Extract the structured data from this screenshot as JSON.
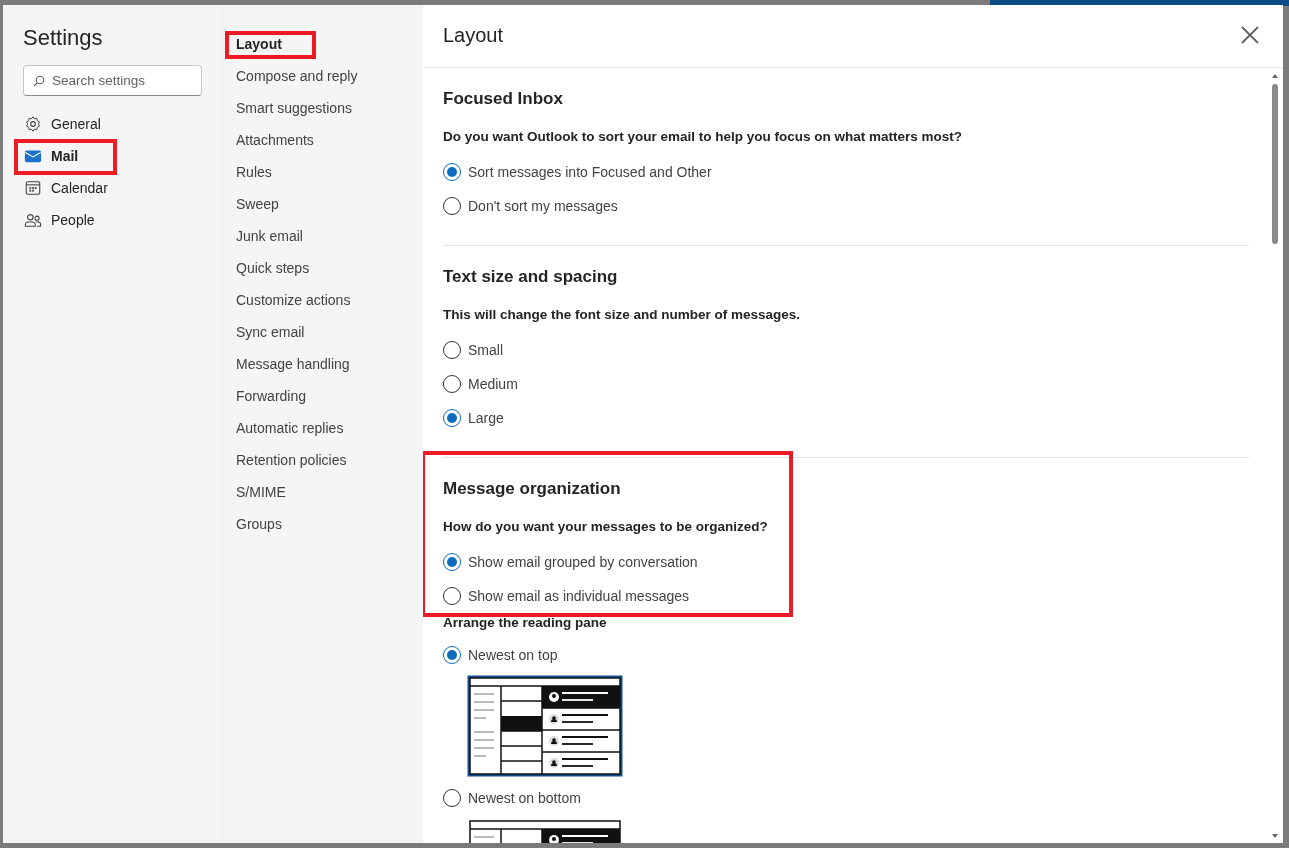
{
  "dialog": {
    "title": "Settings",
    "search": {
      "placeholder": "Search settings"
    },
    "nav": [
      {
        "kind": "general",
        "label": "General",
        "selected": false,
        "annotated": false
      },
      {
        "kind": "mail",
        "label": "Mail",
        "selected": true,
        "annotated": true
      },
      {
        "kind": "calendar",
        "label": "Calendar",
        "selected": false,
        "annotated": false
      },
      {
        "kind": "people",
        "label": "People",
        "selected": false,
        "annotated": false
      }
    ],
    "subnav": [
      {
        "label": "Layout",
        "selected": true,
        "annotated": true
      },
      {
        "label": "Compose and reply",
        "selected": false,
        "annotated": false
      },
      {
        "label": "Smart suggestions",
        "selected": false,
        "annotated": false
      },
      {
        "label": "Attachments",
        "selected": false,
        "annotated": false
      },
      {
        "label": "Rules",
        "selected": false,
        "annotated": false
      },
      {
        "label": "Sweep",
        "selected": false,
        "annotated": false
      },
      {
        "label": "Junk email",
        "selected": false,
        "annotated": false
      },
      {
        "label": "Quick steps",
        "selected": false,
        "annotated": false
      },
      {
        "label": "Customize actions",
        "selected": false,
        "annotated": false
      },
      {
        "label": "Sync email",
        "selected": false,
        "annotated": false
      },
      {
        "label": "Message handling",
        "selected": false,
        "annotated": false
      },
      {
        "label": "Forwarding",
        "selected": false,
        "annotated": false
      },
      {
        "label": "Automatic replies",
        "selected": false,
        "annotated": false
      },
      {
        "label": "Retention policies",
        "selected": false,
        "annotated": false
      },
      {
        "label": "S/MIME",
        "selected": false,
        "annotated": false
      },
      {
        "label": "Groups",
        "selected": false,
        "annotated": false
      }
    ],
    "pane": {
      "title": "Layout",
      "sections": [
        {
          "title": "Focused Inbox",
          "annotated": false,
          "items": [
            {
              "kind": "question",
              "text": "Do you want Outlook to sort your email to help you focus on what matters most?"
            },
            {
              "kind": "radio",
              "label": "Sort messages into Focused and Other",
              "selected": true
            },
            {
              "kind": "radio",
              "label": "Don't sort my messages",
              "selected": false
            }
          ]
        },
        {
          "title": "Text size and spacing",
          "annotated": false,
          "items": [
            {
              "kind": "question",
              "text": "This will change the font size and number of messages."
            },
            {
              "kind": "radio",
              "label": "Small",
              "selected": false
            },
            {
              "kind": "radio",
              "label": "Medium",
              "selected": false
            },
            {
              "kind": "radio",
              "label": "Large",
              "selected": true
            }
          ]
        },
        {
          "title": "Message organization",
          "annotated": true,
          "items": [
            {
              "kind": "question",
              "text": "How do you want your messages to be organized?"
            },
            {
              "kind": "radio",
              "label": "Show email grouped by conversation",
              "selected": true
            },
            {
              "kind": "radio",
              "label": "Show email as individual messages",
              "selected": false
            }
          ]
        },
        {
          "annotated": false,
          "items": [
            {
              "kind": "subheading",
              "text": "Arrange the reading pane"
            },
            {
              "kind": "radio",
              "label": "Newest on top",
              "selected": true
            },
            {
              "kind": "preview",
              "selected": true
            },
            {
              "kind": "radio",
              "label": "Newest on bottom",
              "selected": false
            },
            {
              "kind": "preview",
              "selected": false
            }
          ]
        }
      ]
    }
  }
}
